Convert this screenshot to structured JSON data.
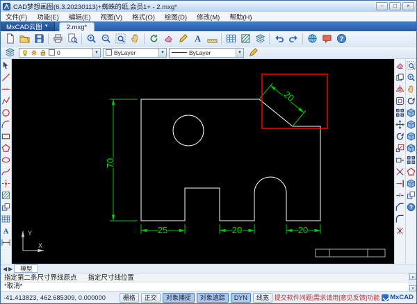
{
  "window": {
    "title": "CAD梦想画图(6.3.20230113)+蜘蛛的纸,会员1+ - 2.mxg*",
    "minimize": "–",
    "maximize": "□",
    "close": "×"
  },
  "menu": {
    "items": [
      "文件(F)",
      "功能(E)",
      "编辑(E)",
      "视图(V)",
      "格式(O)",
      "绘图(D)",
      "修改(M)",
      "帮助(H)"
    ]
  },
  "tabbar": {
    "app_button": "MxCAD云图",
    "document_tab": "2.mxg*"
  },
  "ui": {
    "dropdown_arrow": "▼",
    "up_arrow": "▲",
    "down_arrow": "▼"
  },
  "toolbars": {
    "main_icons": [
      "new",
      "open",
      "save",
      "print",
      "preview",
      "zoom-in",
      "zoom-out",
      "zoom-extents",
      "pan",
      "regen",
      "erase",
      "pencil",
      "text",
      "measure",
      "table",
      "hatch",
      "layers",
      "undo",
      "redo",
      "website",
      "feedback",
      "about"
    ],
    "properties": {
      "layer_value": "0",
      "color_value": "ByLayer",
      "linetype_value": "ByLayer"
    }
  },
  "left_toolbar_icons": [
    "select",
    "line",
    "xline",
    "polyline",
    "circle",
    "arc",
    "rectangle",
    "polygon",
    "ellipse",
    "spline",
    "point",
    "hatch",
    "block",
    "table",
    "text",
    "dimension"
  ],
  "right_modify_icons": [
    "erase",
    "copy",
    "mirror",
    "offset",
    "array",
    "move",
    "rotate",
    "scale",
    "stretch",
    "trim",
    "extend",
    "break",
    "chamfer",
    "fillet",
    "explode"
  ],
  "right_view_icons": [
    "zoom-window",
    "zoom-dynamic",
    "pan-view",
    "orbit",
    "view-top",
    "view-front",
    "view-left",
    "view-iso",
    "shade",
    "wireframe",
    "render",
    "camera",
    "settings"
  ],
  "drawing": {
    "dim_height": "70",
    "dim_left": "25",
    "dim_mid": "20",
    "dim_right": "20",
    "dim_chamfer": "20",
    "ucs_x": "X",
    "ucs_y": "Y",
    "colors": {
      "dimension": "#00cc00",
      "outline": "#ffffff",
      "highlight": "#ff0000"
    }
  },
  "model_bar": {
    "prev": "◀",
    "next": "▶",
    "tab": "模型"
  },
  "command": {
    "history_1": "指定第二条尺寸界线原点      指定尺寸线位置",
    "history_2": "*取消*"
  },
  "statusbar": {
    "coordinates": "-41.413823, 462.685309, 0.000000",
    "toggles": [
      {
        "label": "栅格",
        "active": false
      },
      {
        "label": "正交",
        "active": false
      },
      {
        "label": "对象捕捉",
        "active": true
      },
      {
        "label": "对象追踪",
        "active": true
      },
      {
        "label": "DYN",
        "active": true
      },
      {
        "label": "线宽",
        "active": false
      }
    ],
    "message": "提交软件问题|需求请用[意见反馈]功能",
    "brand": "MxCAD"
  }
}
